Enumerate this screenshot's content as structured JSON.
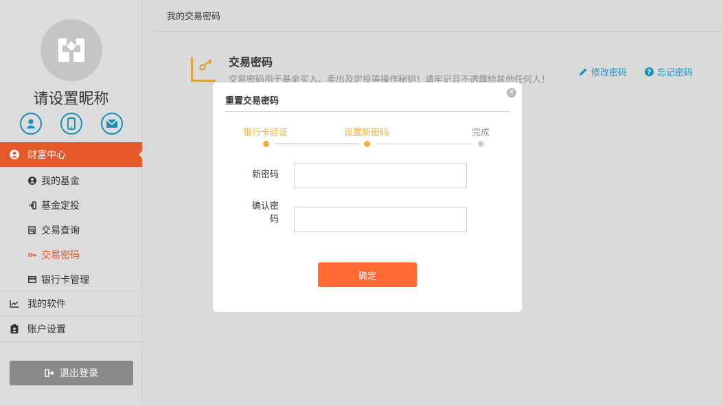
{
  "sidebar": {
    "nickname": "请设置昵称",
    "active_section": "财富中心",
    "sub_items": [
      {
        "label": "我的基金",
        "icon": "user-circle-icon"
      },
      {
        "label": "基金定投",
        "icon": "sign-in-icon"
      },
      {
        "label": "交易查询",
        "icon": "search-doc-icon"
      },
      {
        "label": "交易密码",
        "icon": "key-icon"
      },
      {
        "label": "银行卡管理",
        "icon": "credit-card-icon"
      }
    ],
    "top_items": [
      {
        "label": "我的软件",
        "icon": "chart-line-icon"
      },
      {
        "label": "账户设置",
        "icon": "id-badge-icon"
      }
    ],
    "logout_label": "退出登录",
    "accent_color": "#e5582a"
  },
  "main": {
    "breadcrumb": "我的交易密码",
    "section_title": "交易密码",
    "section_desc": "交易密码用于基金买入、卖出及定投等操作秘钥！请牢记且不透露给其他任何人！",
    "modify_link": "修改密码",
    "forgot_link": "忘记密码",
    "link_color": "#1a8fb8"
  },
  "modal": {
    "title": "重置交易密码",
    "steps": [
      {
        "label": "银行卡验证",
        "state": "done"
      },
      {
        "label": "设置新密码",
        "state": "current"
      },
      {
        "label": "完成",
        "state": "pending"
      }
    ],
    "new_password_label": "新密码",
    "confirm_password_label_line1": "确认密",
    "confirm_password_label_line2": "码",
    "new_password_value": "",
    "confirm_password_value": "",
    "confirm_button": "确定",
    "step_active_color": "#f0b23e",
    "button_color": "#ff6a33"
  }
}
